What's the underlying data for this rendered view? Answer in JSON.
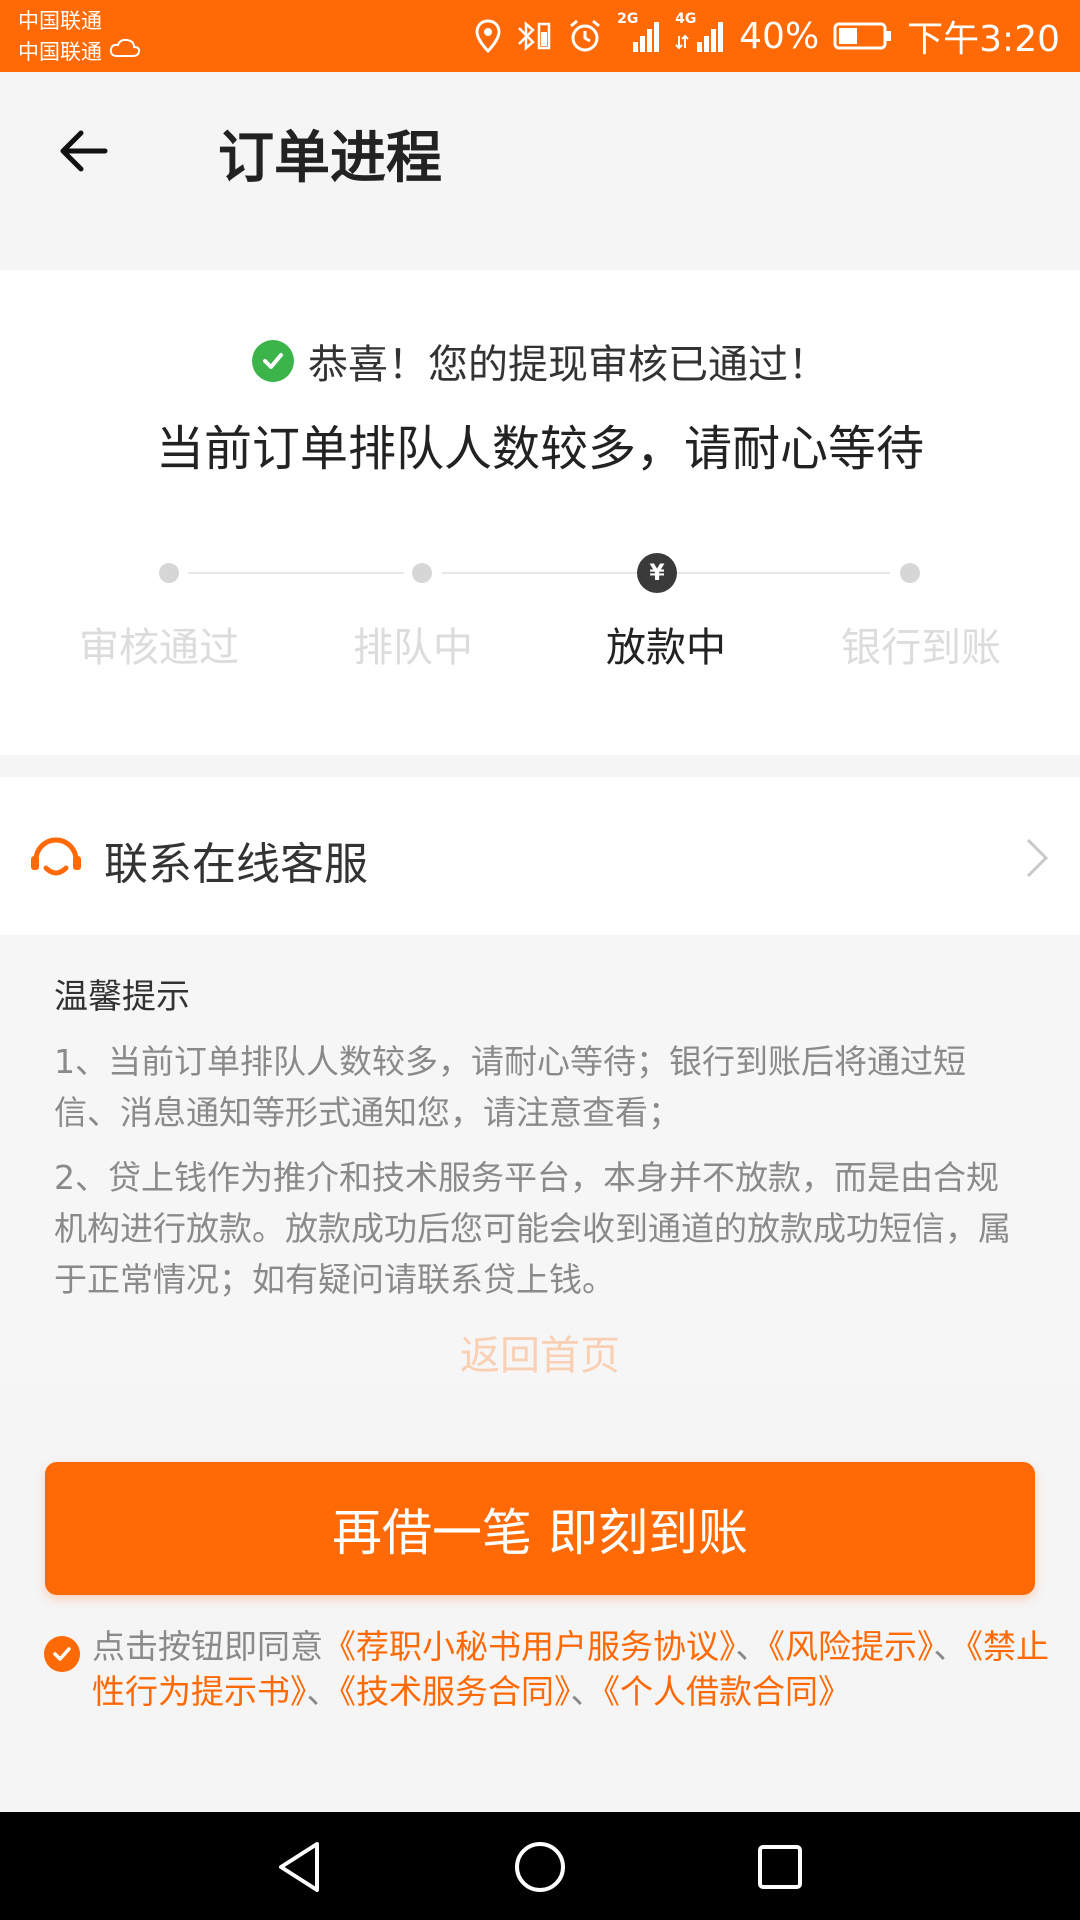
{
  "status_bar": {
    "carrier_1": "中国联通",
    "carrier_2": "中国联通",
    "signal_2g": "2G",
    "signal_4g": "4G",
    "battery": "40%",
    "time": "下午3:20",
    "color": "#ff6a06"
  },
  "header": {
    "title": "订单进程"
  },
  "progress": {
    "success_message": "恭喜！您的提现审核已通过！",
    "queue_message": "当前订单排队人数较多，请耐心等待",
    "current_step_icon": "¥",
    "steps": [
      {
        "label": "审核通过",
        "state": "inactive"
      },
      {
        "label": "排队中",
        "state": "inactive"
      },
      {
        "label": "放款中",
        "state": "active"
      },
      {
        "label": "银行到账",
        "state": "inactive"
      }
    ]
  },
  "service": {
    "label": "联系在线客服",
    "icon": "customer-service-icon"
  },
  "tips": {
    "title": "温馨提示",
    "items": [
      "1、当前订单排队人数较多，请耐心等待；银行到账后将通过短信、消息通知等形式通知您，请注意查看；",
      "2、贷上钱作为推介和技术服务平台，本身并不放款，而是由合规机构进行放款。放款成功后您可能会收到通道的放款成功短信，属于正常情况；如有疑问请联系贷上钱。"
    ],
    "back_home": "返回首页"
  },
  "main_button": {
    "label": "再借一笔 即刻到账",
    "color": "#ff6a06"
  },
  "agreement": {
    "prefix": "点击按钮即同意",
    "links": [
      "《荐职小秘书用户服务协议》",
      "《风险提示》",
      "《禁止性行为提示书》",
      "《技术服务合同》",
      "《个人借款合同》"
    ],
    "separator": "、"
  }
}
